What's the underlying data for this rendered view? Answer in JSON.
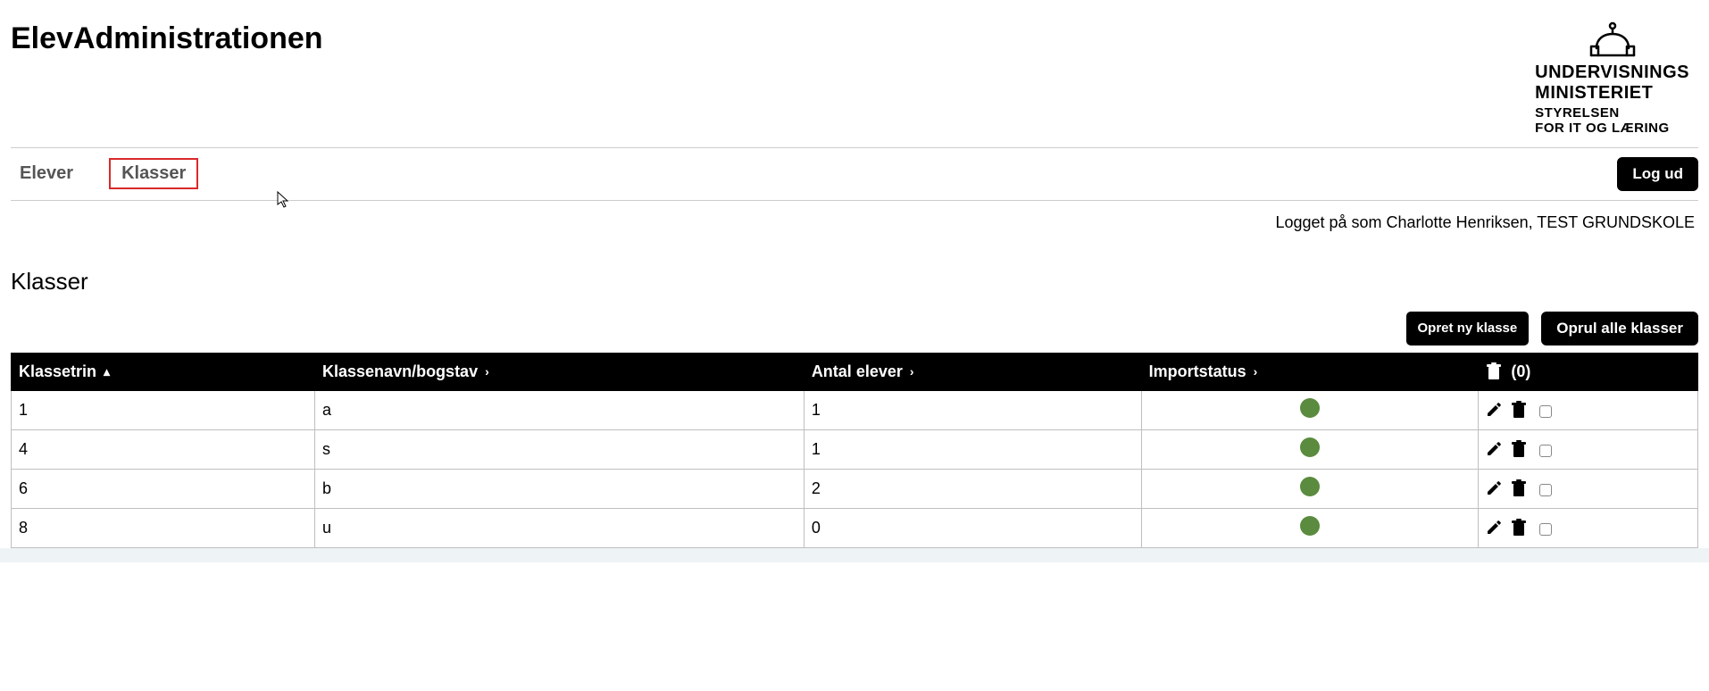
{
  "header": {
    "title": "ElevAdministrationen",
    "logo": {
      "line1": "UNDERVISNINGS",
      "line2": "MINISTERIET",
      "line3": "STYRELSEN",
      "line4": "FOR IT OG LÆRING"
    }
  },
  "nav": {
    "tabs": [
      {
        "label": "Elever",
        "active": false
      },
      {
        "label": "Klasser",
        "active": true
      }
    ],
    "logout": "Log ud"
  },
  "status_line": "Logget på som Charlotte Henriksen, TEST GRUNDSKOLE",
  "page": {
    "heading": "Klasser",
    "actions": {
      "create": "Opret ny klasse",
      "roll_all": "Oprul alle klasser"
    }
  },
  "table": {
    "columns": {
      "klassetrin": "Klassetrin",
      "klassenavn": "Klassenavn/bogstav",
      "antal": "Antal elever",
      "importstatus": "Importstatus",
      "trash_count": "(0)"
    },
    "rows": [
      {
        "klassetrin": "1",
        "klassenavn": "a",
        "antal": "1",
        "status": "ok"
      },
      {
        "klassetrin": "4",
        "klassenavn": "s",
        "antal": "1",
        "status": "ok"
      },
      {
        "klassetrin": "6",
        "klassenavn": "b",
        "antal": "2",
        "status": "ok"
      },
      {
        "klassetrin": "8",
        "klassenavn": "u",
        "antal": "0",
        "status": "ok"
      }
    ]
  }
}
